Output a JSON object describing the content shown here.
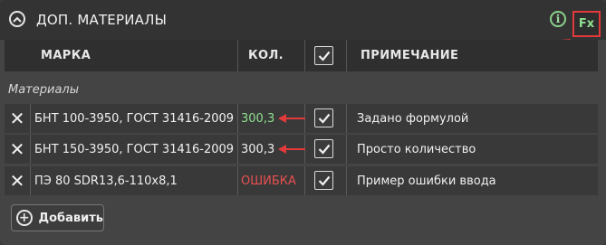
{
  "panel": {
    "title": "ДОП. МАТЕРИАЛЫ",
    "info_symbol": "i",
    "fx_label": "Fx"
  },
  "table": {
    "columns": [
      "МАРКА",
      "КОЛ.",
      "",
      "ПРИМЕЧАНИЕ"
    ],
    "section_label": "Материалы",
    "rows": [
      {
        "mark": "БНТ 100-3950, ГОСТ 31416-2009",
        "qty": "300,3",
        "checked": true,
        "note": "Задано формулой"
      },
      {
        "mark": "БНТ 150-3950, ГОСТ 31416-2009",
        "qty": "300,3",
        "checked": true,
        "note": "Просто количество"
      },
      {
        "mark": "ПЭ 80 SDR13,6-110х8,1",
        "qty": "ОШИБКА",
        "checked": true,
        "note": "Пример ошибки ввода"
      }
    ]
  },
  "add_button": {
    "label": "Добавить"
  },
  "colors": {
    "formula_value": "#8fe08f",
    "error_value": "#e85050",
    "annotation_arrow": "#e23a3a"
  },
  "icons": [
    "chevron-up-icon",
    "info-icon",
    "close-icon",
    "checkbox-checked-icon",
    "plus-circle-icon",
    "annotation-arrow-icon"
  ]
}
